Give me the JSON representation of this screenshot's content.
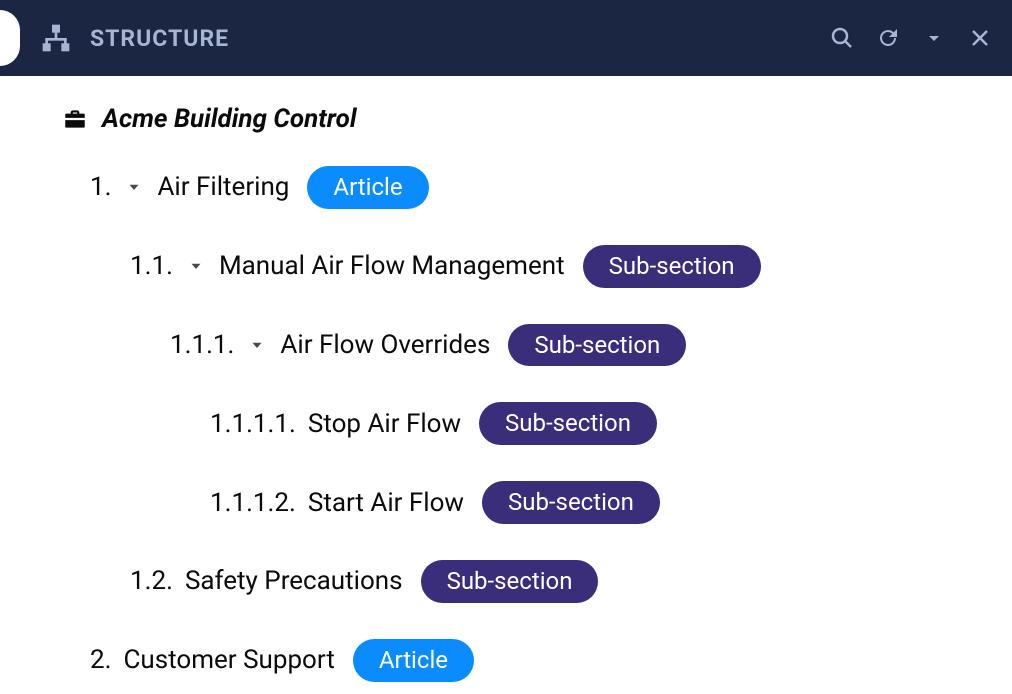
{
  "header": {
    "title": "STRUCTURE"
  },
  "root": {
    "title": "Acme Building Control"
  },
  "badges": {
    "article": "Article",
    "subsection": "Sub-section"
  },
  "nodes": [
    {
      "num": "1.",
      "label": "Air Filtering",
      "badge": "article",
      "caret": true,
      "indent": 1
    },
    {
      "num": "1.1.",
      "label": "Manual Air Flow Management",
      "badge": "subsection",
      "caret": true,
      "indent": 2
    },
    {
      "num": "1.1.1.",
      "label": "Air Flow Overrides",
      "badge": "subsection",
      "caret": true,
      "indent": 3
    },
    {
      "num": "1.1.1.1.",
      "label": "Stop Air Flow",
      "badge": "subsection",
      "caret": false,
      "indent": 4
    },
    {
      "num": "1.1.1.2.",
      "label": "Start Air Flow",
      "badge": "subsection",
      "caret": false,
      "indent": 4
    },
    {
      "num": "1.2.",
      "label": "Safety Precautions",
      "badge": "subsection",
      "caret": false,
      "indent": 2
    },
    {
      "num": "2.",
      "label": "Customer Support",
      "badge": "article",
      "caret": false,
      "indent": 1
    }
  ]
}
